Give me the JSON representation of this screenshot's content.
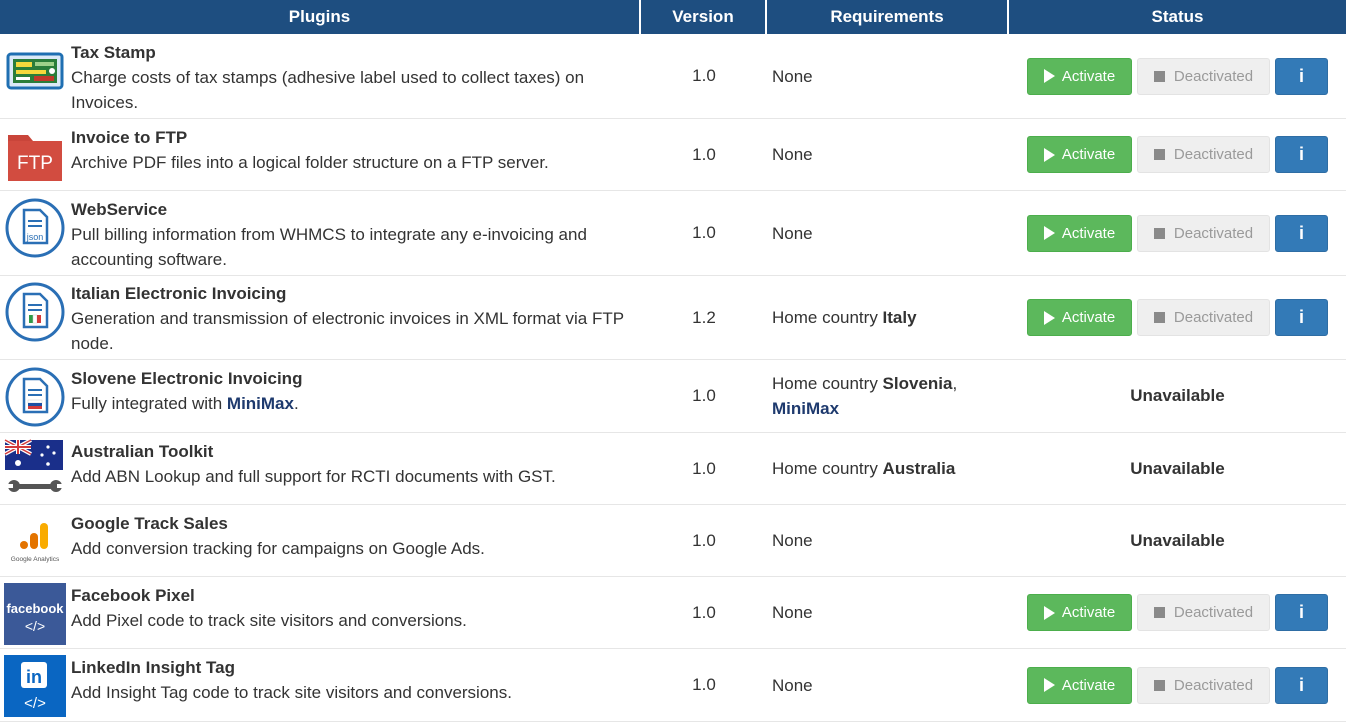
{
  "headers": {
    "plugins": "Plugins",
    "version": "Version",
    "requirements": "Requirements",
    "status": "Status"
  },
  "buttons": {
    "activate": "Activate",
    "deactivated": "Deactivated",
    "info": "i",
    "unavailable": "Unavailable"
  },
  "icon_texts": {
    "ftp": "FTP",
    "json": "json",
    "analytics": "Google Analytics",
    "facebook": "facebook",
    "code": "</>",
    "linkedin": "in"
  },
  "colors": {
    "header": "#1e4e80",
    "activate": "#5cb85c",
    "deactivated": "#efefef",
    "info": "#337ab7",
    "highlight": "#1e3a6e"
  },
  "plugins": [
    {
      "name": "Tax Stamp",
      "icon": "tax-stamp-icon",
      "description": "Charge costs of tax stamps (adhesive label used to collect taxes) on Invoices.",
      "version": "1.0",
      "requirement": "None",
      "status": "buttons"
    },
    {
      "name": "Invoice to FTP",
      "icon": "ftp-folder-icon",
      "description": "Archive PDF files into a logical folder structure on a FTP server.",
      "version": "1.0",
      "requirement": "None",
      "status": "buttons"
    },
    {
      "name": "WebService",
      "icon": "json-document-icon",
      "description": "Pull billing information from WHMCS to integrate any e-invoicing and accounting software.",
      "version": "1.0",
      "requirement": "None",
      "status": "buttons"
    },
    {
      "name": "Italian Electronic Invoicing",
      "icon": "italy-document-icon",
      "description": "Generation and transmission of electronic invoices in XML format via FTP node.",
      "version": "1.2",
      "req_prefix": "Home country ",
      "req_bold": "Italy",
      "status": "buttons"
    },
    {
      "name": "Slovene Electronic Invoicing",
      "icon": "slovenia-document-icon",
      "description_prefix": "Fully integrated with ",
      "description_link": "MiniMax",
      "description_suffix": ".",
      "version": "1.0",
      "req_prefix": "Home country ",
      "req_bold": "Slovenia",
      "req_sep": ",",
      "req_link": "MiniMax",
      "status": "unavailable"
    },
    {
      "name": "Australian Toolkit",
      "icon": "australia-wrench-icon",
      "description": "Add ABN Lookup and full support for RCTI documents with GST.",
      "version": "1.0",
      "req_prefix": "Home country ",
      "req_bold": "Australia",
      "status": "unavailable"
    },
    {
      "name": "Google Track Sales",
      "icon": "google-analytics-icon",
      "description": "Add conversion tracking for campaigns on Google Ads.",
      "version": "1.0",
      "requirement": "None",
      "status": "unavailable"
    },
    {
      "name": "Facebook Pixel",
      "icon": "facebook-code-icon",
      "description": "Add Pixel code to track site visitors and conversions.",
      "version": "1.0",
      "requirement": "None",
      "status": "buttons"
    },
    {
      "name": "LinkedIn Insight Tag",
      "icon": "linkedin-code-icon",
      "description": "Add Insight Tag code to track site visitors and conversions.",
      "version": "1.0",
      "requirement": "None",
      "status": "buttons"
    }
  ]
}
